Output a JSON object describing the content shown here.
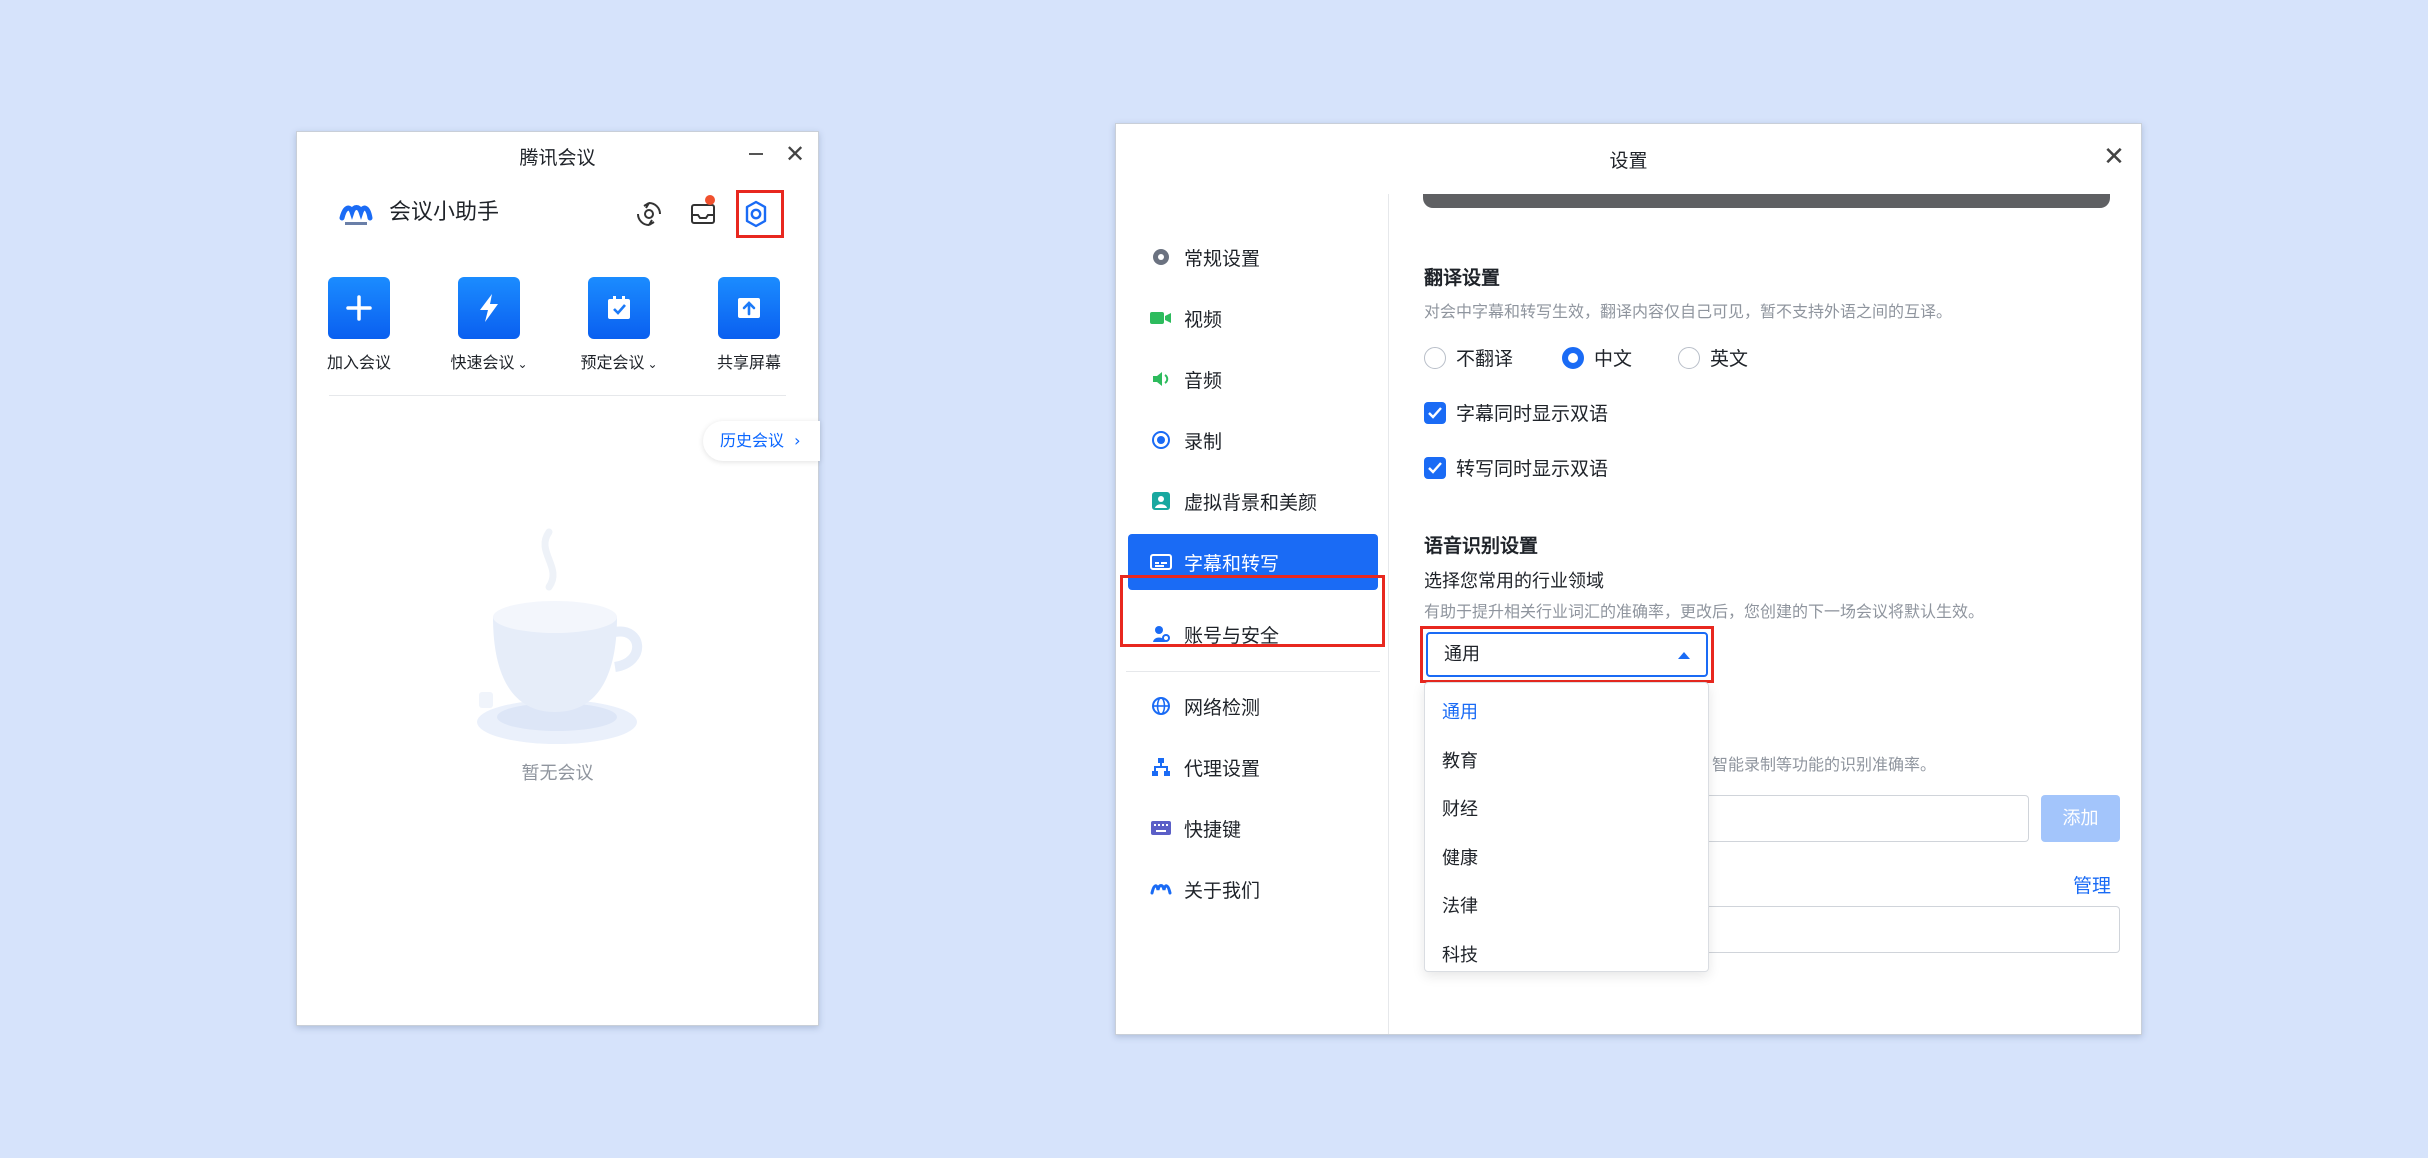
{
  "main_window": {
    "title": "腾讯会议",
    "close_glyph": "✕",
    "app_name": "会议小助手",
    "quick_actions": [
      {
        "label": "加入会议",
        "icon": "plus-icon",
        "has_dropdown": false
      },
      {
        "label": "快速会议",
        "icon": "lightning-icon",
        "has_dropdown": true
      },
      {
        "label": "预定会议",
        "icon": "calendar-icon",
        "has_dropdown": true
      },
      {
        "label": "共享屏幕",
        "icon": "share-screen-icon",
        "has_dropdown": false
      }
    ],
    "dropdown_chevron": "⌄",
    "history_label": "历史会议",
    "history_chevron": "›",
    "empty_text": "暂无会议"
  },
  "settings": {
    "title": "设置",
    "close_glyph": "✕",
    "nav": [
      {
        "label": "常规设置",
        "icon": "gear-icon",
        "active": false
      },
      {
        "label": "视频",
        "icon": "video-icon",
        "active": false
      },
      {
        "label": "音频",
        "icon": "speaker-icon",
        "active": false
      },
      {
        "label": "录制",
        "icon": "record-icon",
        "active": false
      },
      {
        "label": "虚拟背景和美颜",
        "icon": "portrait-icon",
        "active": false
      },
      {
        "label": "字幕和转写",
        "icon": "subtitle-icon",
        "active": true
      },
      {
        "label": "账号与安全",
        "icon": "account-security-icon",
        "active": false
      },
      {
        "label": "网络检测",
        "icon": "globe-icon",
        "active": false
      },
      {
        "label": "代理设置",
        "icon": "proxy-icon",
        "active": false
      },
      {
        "label": "快捷键",
        "icon": "keyboard-icon",
        "active": false
      },
      {
        "label": "关于我们",
        "icon": "logo-icon",
        "active": false
      }
    ],
    "translation": {
      "title": "翻译设置",
      "description": "对会中字幕和转写生效，翻译内容仅自己可见，暂不支持外语之间的互译。",
      "options": [
        {
          "label": "不翻译",
          "selected": false
        },
        {
          "label": "中文",
          "selected": true
        },
        {
          "label": "英文",
          "selected": false
        }
      ],
      "checkboxes": [
        {
          "label": "字幕同时显示双语",
          "checked": true
        },
        {
          "label": "转写同时显示双语",
          "checked": true
        }
      ]
    },
    "speech": {
      "title": "语音识别设置",
      "industry_label": "选择您常用的行业领域",
      "industry_desc": "有助于提升相关行业词汇的准确率，更改后，您创建的下一场会议将默认生效。",
      "selected_industry": "通用",
      "industry_options": [
        "通用",
        "教育",
        "财经",
        "健康",
        "法律",
        "科技"
      ],
      "partial_desc": "智能录制等功能的识别准确率。",
      "add_button": "添加",
      "manage_link": "管理"
    }
  }
}
